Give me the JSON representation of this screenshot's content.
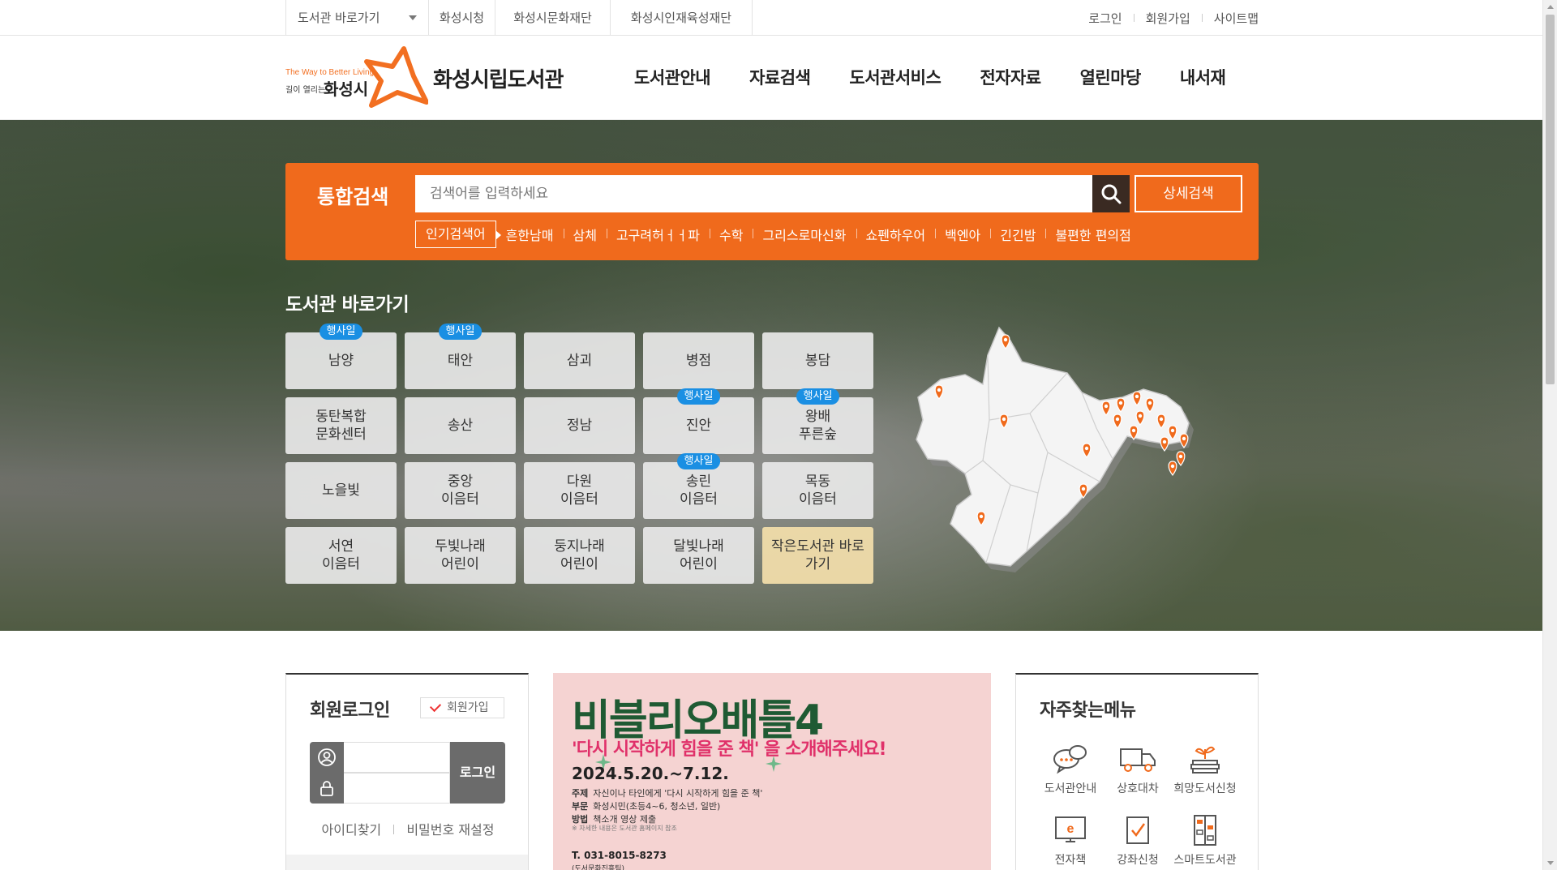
{
  "topbar": {
    "quick_select": "도서관 바로가기",
    "links": [
      "화성시청",
      "화성시문화재단",
      "화성시인재육성재단"
    ],
    "util": [
      "로그인",
      "회원가입",
      "사이트맵"
    ]
  },
  "header": {
    "logo_tagline_en": "The Way to Better Living",
    "logo_tagline_ko": "길이 열리는",
    "logo_city": "화성시",
    "library_name": "화성시립도서관",
    "nav": [
      "도서관안내",
      "자료검색",
      "도서관서비스",
      "전자자료",
      "열린마당",
      "내서재"
    ]
  },
  "search": {
    "title": "통합검색",
    "placeholder": "검색어를 입력하세요",
    "detail_button": "상세검색",
    "popular_label": "인기검색어",
    "keywords": [
      "흔한남매",
      "삼체",
      "고구려허ㅓㅓ파",
      "수학",
      "그리스로마신화",
      "쇼펜하우어",
      "백엔아",
      "긴긴밤",
      "불편한 편의점"
    ]
  },
  "shortcuts": {
    "title": "도서관 바로가기",
    "badge_text": "행사일",
    "libraries": [
      {
        "name": "남양",
        "badge": true
      },
      {
        "name": "태안",
        "badge": true
      },
      {
        "name": "삼괴",
        "badge": false
      },
      {
        "name": "병점",
        "badge": false
      },
      {
        "name": "봉담",
        "badge": false
      },
      {
        "name": "동탄복합\n문화센터",
        "badge": false
      },
      {
        "name": "송산",
        "badge": false
      },
      {
        "name": "정남",
        "badge": false
      },
      {
        "name": "진안",
        "badge": true
      },
      {
        "name": "왕배\n푸른숲",
        "badge": true
      },
      {
        "name": "노을빛",
        "badge": false
      },
      {
        "name": "중앙\n이음터",
        "badge": false
      },
      {
        "name": "다원\n이음터",
        "badge": false
      },
      {
        "name": "송린\n이음터",
        "badge": true
      },
      {
        "name": "목동\n이음터",
        "badge": false
      },
      {
        "name": "서연\n이음터",
        "badge": false
      },
      {
        "name": "두빛나래\n어린이",
        "badge": false
      },
      {
        "name": "둥지나래\n어린이",
        "badge": false
      },
      {
        "name": "달빛나래\n어린이",
        "badge": false
      },
      {
        "name": "작은도서관 바로\n가기",
        "badge": false,
        "special": true
      }
    ]
  },
  "login": {
    "title": "회원로그인",
    "join_chip": "회원가입",
    "button": "로그인",
    "find_id": "아이디찾기",
    "reset_pw": "비밀번호 재설정"
  },
  "banner": {
    "title": "비블리오배틀4",
    "subtitle": "'다시 시작하게 힘을 준 책' 을 소개해주세요!",
    "date": "2024.5.20.~7.12.",
    "rows": [
      {
        "k": "주제",
        "v": "자신이나 타인에게 '다시 시작하게 힘을 준 책'"
      },
      {
        "k": "부문",
        "v": "화성시민(초등4~6, 청소년, 일반)"
      },
      {
        "k": "방법",
        "v": "책소개 영상 제출"
      }
    ],
    "note": "※ 자세한 내용은 도서관 홈페이지 참조",
    "tel": "T. 031-8015-8273",
    "dept": "(도서문화진흥팀)"
  },
  "favorites": {
    "title": "자주찾는메뉴",
    "items": [
      {
        "label": "도서관안내",
        "icon": "speech-bubble-icon"
      },
      {
        "label": "상호대차",
        "icon": "delivery-truck-icon"
      },
      {
        "label": "희망도서신청",
        "icon": "book-plant-icon"
      },
      {
        "label": "전자책",
        "icon": "ebook-monitor-icon"
      },
      {
        "label": "강좌신청",
        "icon": "checklist-icon"
      },
      {
        "label": "스마트도서관",
        "icon": "smart-shelf-icon"
      }
    ]
  },
  "colors": {
    "accent": "#f06a1c",
    "badge": "#1a8fe3",
    "banner_bg": "#f5d3d2",
    "banner_title": "#1f5a33",
    "banner_sub": "#e0316a"
  }
}
